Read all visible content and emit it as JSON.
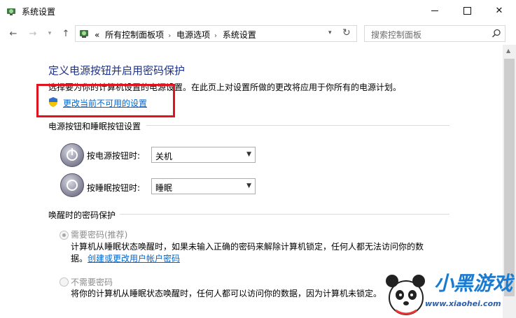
{
  "window": {
    "title": "系统设置",
    "controls": {
      "minimize": "minimize",
      "maximize": "maximize",
      "close": "✕"
    }
  },
  "nav": {
    "back": "←",
    "forward": "→",
    "history": "▾",
    "up": "↑",
    "breadcrumb": [
      "所有控制面板项",
      "电源选项",
      "系统设置"
    ],
    "overflow": "«",
    "separator": "›",
    "refresh": "↻",
    "search_placeholder": "搜索控制面板"
  },
  "page": {
    "heading": "定义电源按钮并启用密码保护",
    "description": "选择要为你的计算机设置的电源设置。在此页上对设置所做的更改将应用于你所有的电源计划。",
    "change_link": "更改当前不可用的设置",
    "buttons_group": {
      "title": "电源按钮和睡眠按钮设置",
      "power_label": "按电源按钮时:",
      "power_value": "关机",
      "sleep_label": "按睡眠按钮时:",
      "sleep_value": "睡眠"
    },
    "password_group": {
      "title": "唤醒时的密码保护",
      "option1_label": "需要密码(推荐)",
      "option1_desc_line1": "计算机从睡眠状态唤醒时，如果未输入正确的密码来解除计算机锁定，任何人都无法访问你的数",
      "option1_desc_line2_prefix": "据。",
      "option1_link": "创建或更改用户帐户密码",
      "option2_label": "不需要密码",
      "option2_desc": "将你的计算机从睡眠状态唤醒时，任何人都可以访问你的数据，因为计算机未锁定。"
    }
  },
  "watermark": {
    "logo_text": "小黑游戏",
    "url": "www.xiaohei.com"
  },
  "colors": {
    "heading": "#1e3287",
    "link": "#0066cc",
    "highlight_box": "#e0141e"
  }
}
